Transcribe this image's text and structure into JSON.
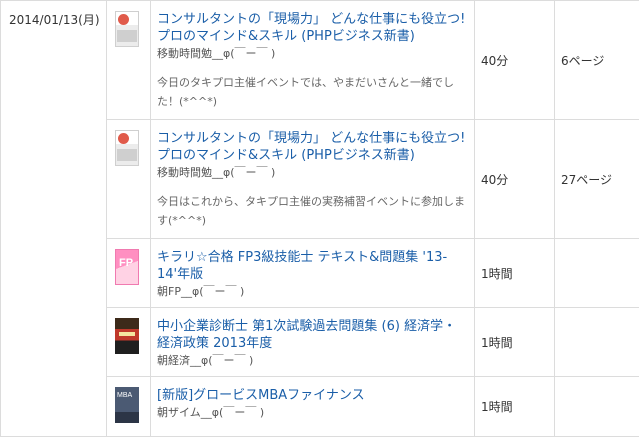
{
  "date": "2014/01/13(月)",
  "rows": [
    {
      "title": "コンサルタントの「現場力」 どんな仕事にも役立つ! プロのマインド&スキル (PHPビジネス新書)",
      "category": "移動時間勉__φ(￣ー￣ )",
      "comment": "今日のタキプロ主催イベントでは、やまだいさんと一緒でした！(*^^*)",
      "time": "40分",
      "amount": "6ページ",
      "cover_icon": "book-cover-consultant"
    },
    {
      "title": "コンサルタントの「現場力」 どんな仕事にも役立つ! プロのマインド&スキル (PHPビジネス新書)",
      "category": "移動時間勉__φ(￣ー￣ )",
      "comment": "今日はこれから、タキプロ主催の実務補習イベントに参加します(*^^*)",
      "time": "40分",
      "amount": "27ページ",
      "cover_icon": "book-cover-consultant"
    },
    {
      "title": "キラリ☆合格 FP3級技能士 テキスト&問題集 '13-14'年版",
      "category": "朝FP__φ(￣ー￣ )",
      "comment": "",
      "time": "1時間",
      "amount": "",
      "cover_icon": "book-cover-fp"
    },
    {
      "title": "中小企業診断士 第1次試験過去問題集 (6) 経済学・経済政策 2013年度",
      "category": "朝経済__φ(￣ー￣ )",
      "comment": "",
      "time": "1時間",
      "amount": "",
      "cover_icon": "book-cover-economics"
    },
    {
      "title": "[新版]グロービスMBAファイナンス",
      "category": "朝ザイム__φ(￣ー￣ )",
      "comment": "",
      "time": "1時間",
      "amount": "",
      "cover_icon": "book-cover-mba"
    }
  ]
}
